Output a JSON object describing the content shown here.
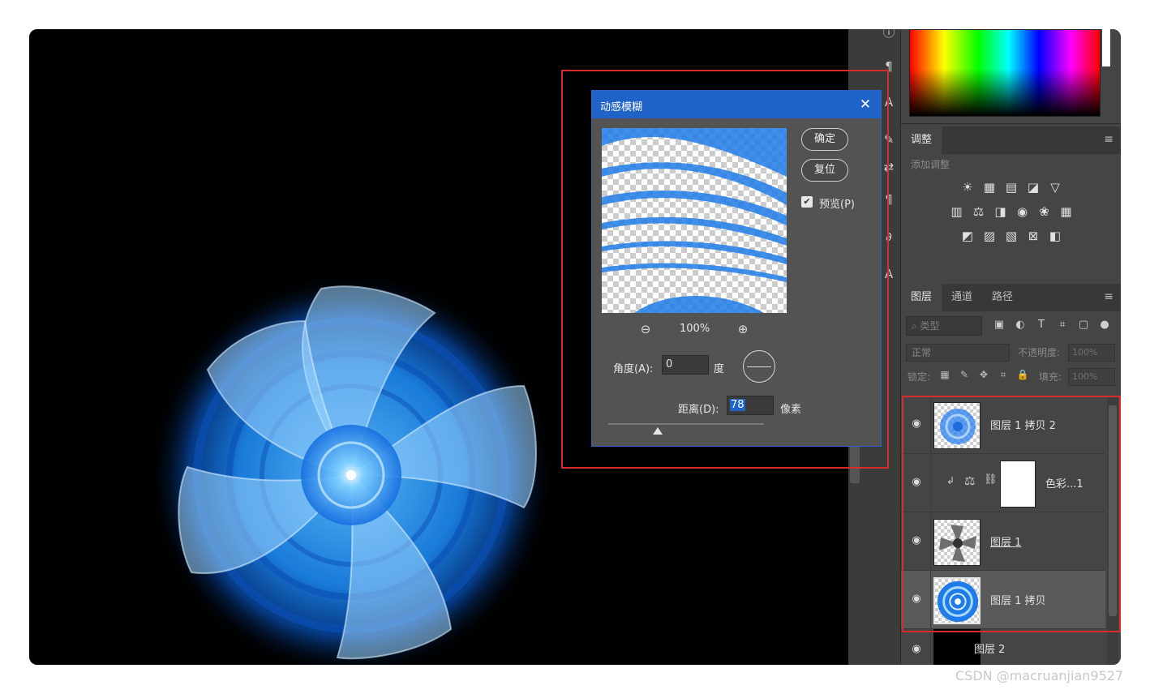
{
  "dialog": {
    "title": "动感模糊",
    "ok_label": "确定",
    "reset_label": "复位",
    "preview_label": "预览(P)",
    "preview_checked": true,
    "zoom_level": "100%",
    "angle_label": "角度(A):",
    "angle_value": "0",
    "angle_unit": "度",
    "distance_label": "距离(D):",
    "distance_value": "78",
    "distance_unit": "像素",
    "distance_slider_fraction": 0.32
  },
  "adjustments": {
    "tab_label": "调整",
    "subtitle": "添加调整"
  },
  "layers_panel": {
    "tabs": [
      "图层",
      "通道",
      "路径"
    ],
    "filter_placeholder": "类型",
    "blend_mode": "正常",
    "opacity_label": "不透明度:",
    "opacity_value": "100%",
    "lock_label": "锁定:",
    "fill_label": "填充:",
    "fill_value": "100%",
    "layers": [
      {
        "name": "图层 1 拷贝 2",
        "visible": true,
        "selected": false
      },
      {
        "name": "色彩...1",
        "visible": true,
        "selected": false
      },
      {
        "name": "图层 1",
        "visible": true,
        "selected": false
      },
      {
        "name": "图层 1 拷贝",
        "visible": true,
        "selected": true
      },
      {
        "name": "图层 2",
        "visible": true,
        "selected": false
      }
    ]
  },
  "watermark": "CSDN @macruanjian9527",
  "colors": {
    "dialog_title_bg": "#1f63c8",
    "highlight": "#d62c2c",
    "fan_blue": "#1e90ff",
    "panel_bg": "#454545"
  },
  "icons": {
    "close": "close-icon",
    "zoom_out": "zoom-out-icon",
    "zoom_in": "zoom-in-icon",
    "eye": "eye-icon",
    "menu": "panel-menu-icon"
  }
}
